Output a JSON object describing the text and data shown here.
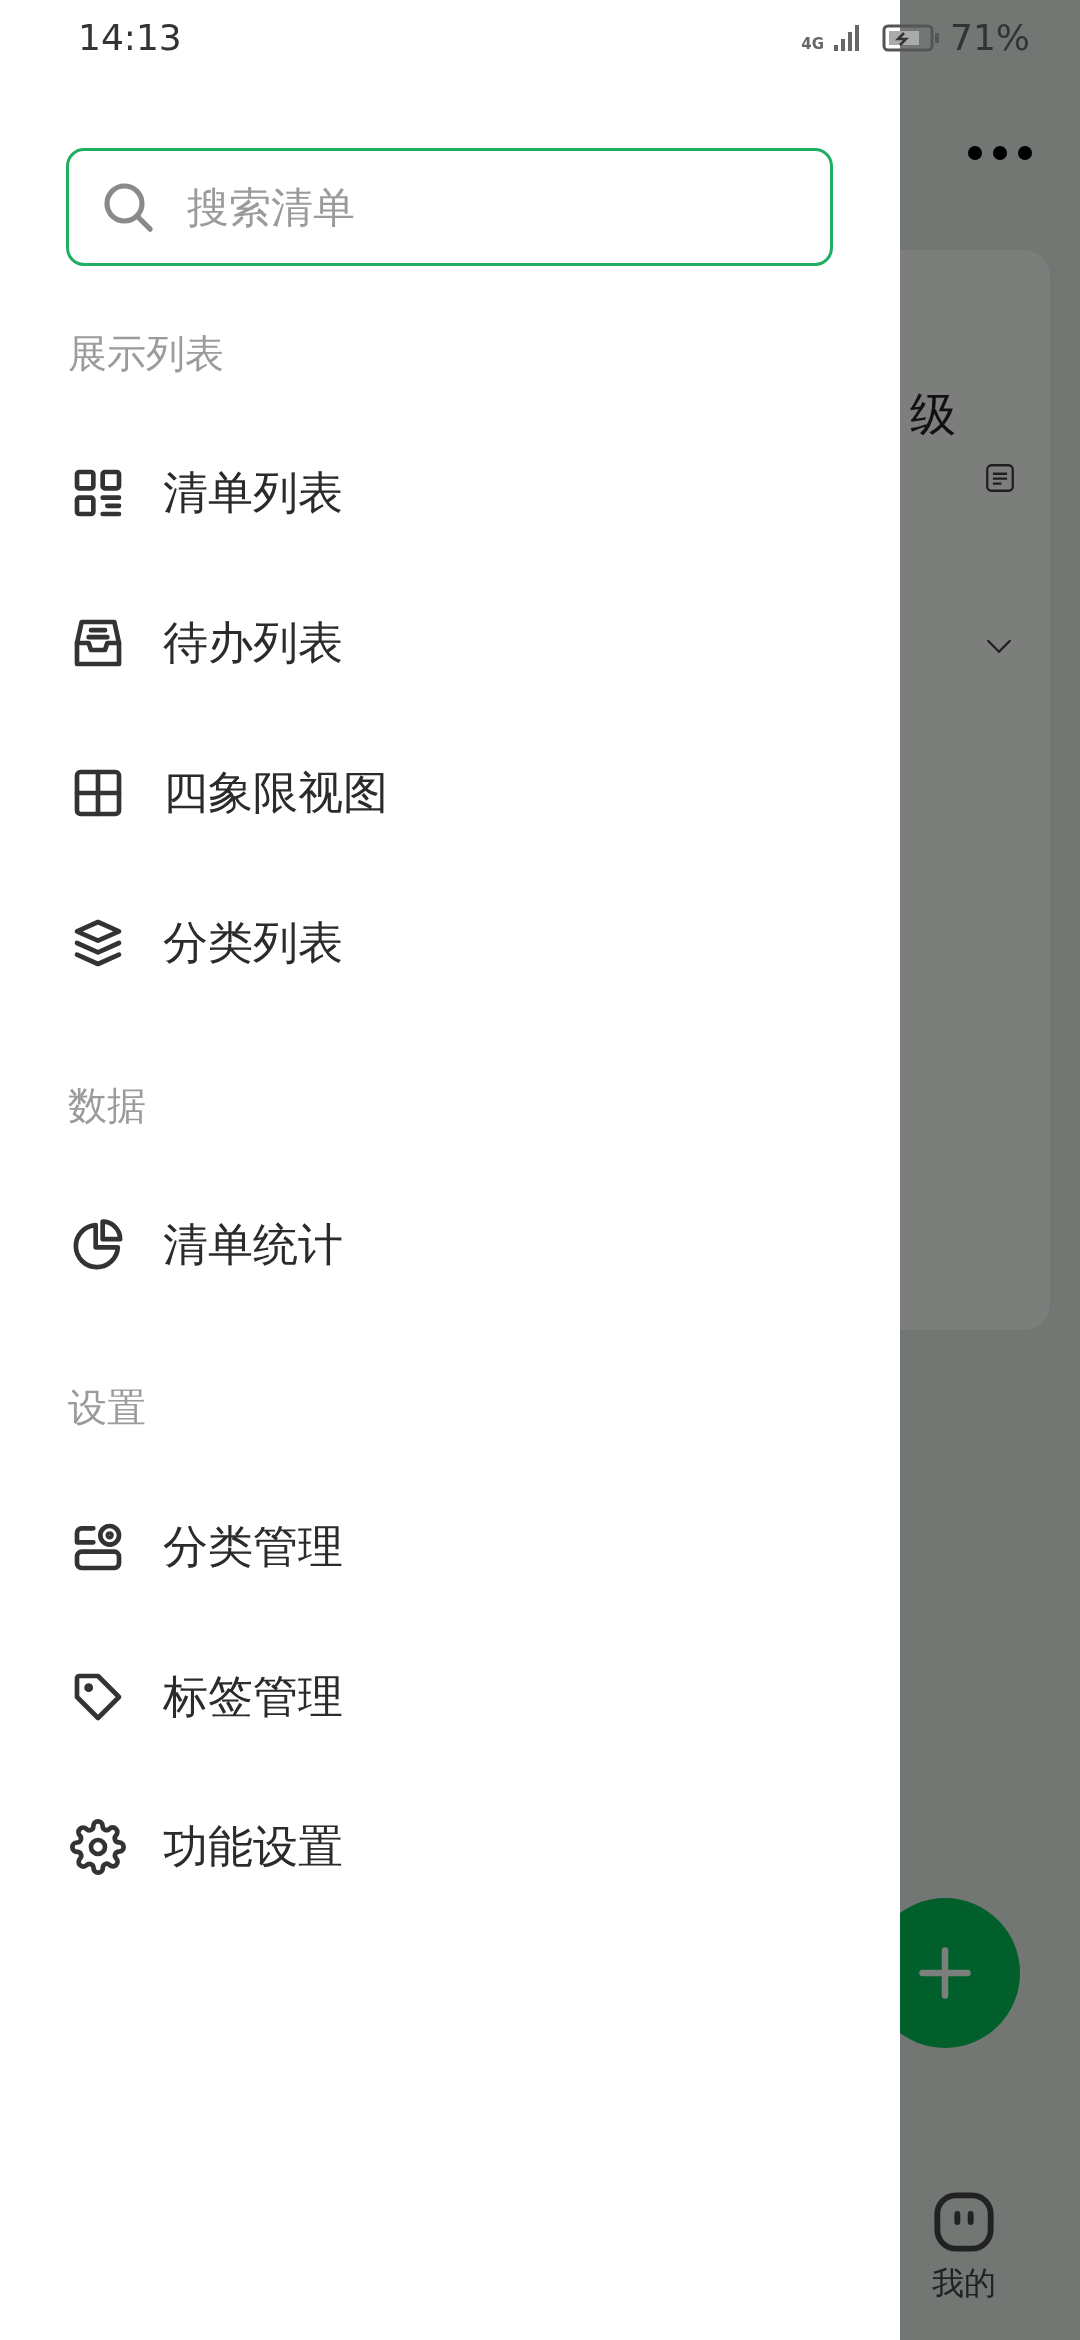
{
  "status_bar": {
    "time": "14:13",
    "network": "4G",
    "battery": "71%"
  },
  "search": {
    "placeholder": "搜索清单"
  },
  "sections": [
    {
      "title": "展示列表",
      "items": [
        {
          "label": "清单列表",
          "kind": "grid"
        },
        {
          "label": "待办列表",
          "kind": "inbox"
        },
        {
          "label": "四象限视图",
          "kind": "quadrant"
        },
        {
          "label": "分类列表",
          "kind": "layers"
        }
      ]
    },
    {
      "title": "数据",
      "items": [
        {
          "label": "清单统计",
          "kind": "pie"
        }
      ]
    },
    {
      "title": "设置",
      "items": [
        {
          "label": "分类管理",
          "kind": "category"
        },
        {
          "label": "标签管理",
          "kind": "tag"
        },
        {
          "label": "功能设置",
          "kind": "gear"
        }
      ]
    }
  ],
  "background": {
    "card_text": "级",
    "nav_label": "我的"
  }
}
